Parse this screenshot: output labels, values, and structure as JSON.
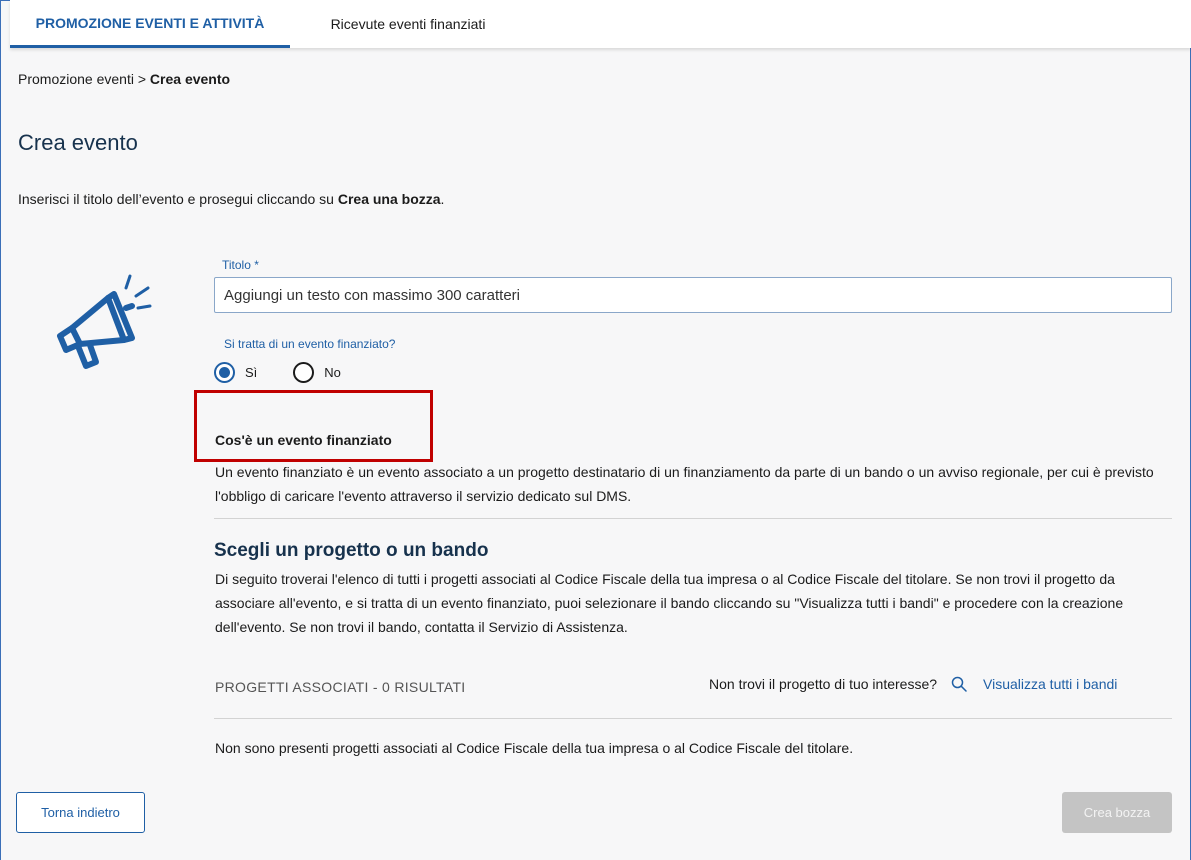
{
  "tabs": [
    {
      "label": "PROMOZIONE EVENTI E ATTIVITÀ",
      "active": true
    },
    {
      "label": "Ricevute eventi finanziati",
      "active": false
    }
  ],
  "breadcrumb": {
    "parent": "Promozione eventi",
    "separator": ">",
    "current": "Crea evento"
  },
  "page": {
    "title": "Crea evento",
    "intro_prefix": "Inserisci il titolo dell’evento e prosegui cliccando su ",
    "intro_bold": "Crea una bozza",
    "intro_suffix": "."
  },
  "form": {
    "title_label": "Titolo *",
    "title_placeholder": "Aggiungi un testo con massimo 300 caratteri",
    "financed_question": "Si tratta di un evento finanziato?",
    "options": [
      {
        "label": "Sì",
        "checked": true
      },
      {
        "label": "No",
        "checked": false
      }
    ]
  },
  "info": {
    "title": "Cos'è un evento finanziato",
    "text": "Un evento finanziato è un evento associato a un progetto destinatario di un finanziamento da parte di un bando o un avviso regionale, per cui è previsto l'obbligo di caricare l'evento attraverso il servizio dedicato sul DMS."
  },
  "project_section": {
    "title": "Scegli un progetto o un bando",
    "text": "Di seguito troverai l'elenco di tutti i progetti associati al Codice Fiscale della tua impresa o al Codice Fiscale del titolare. Se non trovi il progetto da associare all'evento, e si tratta di un evento finanziato, puoi selezionare il bando cliccando su \"Visualizza tutti i bandi\" e procedere con la creazione dell'evento. Se non trovi il bando, contatta il Servizio di Assistenza.",
    "results_header": "PROGETTI ASSOCIATI - 0 RISULTATI",
    "not_found_question": "Non trovi il progetto di tuo interesse?",
    "view_all_link": "Visualizza tutti i bandi",
    "empty_message": "Non sono presenti progetti associati al Codice Fiscale della tua impresa o al Codice Fiscale del titolare."
  },
  "actions": {
    "back_label": "Torna indietro",
    "draft_label": "Crea bozza"
  },
  "colors": {
    "accent": "#1f5fa5",
    "highlight": "#c00000",
    "disabled": "#c4c4c4"
  },
  "icons": {
    "illustration": "megaphone-icon",
    "search": "search-icon"
  }
}
